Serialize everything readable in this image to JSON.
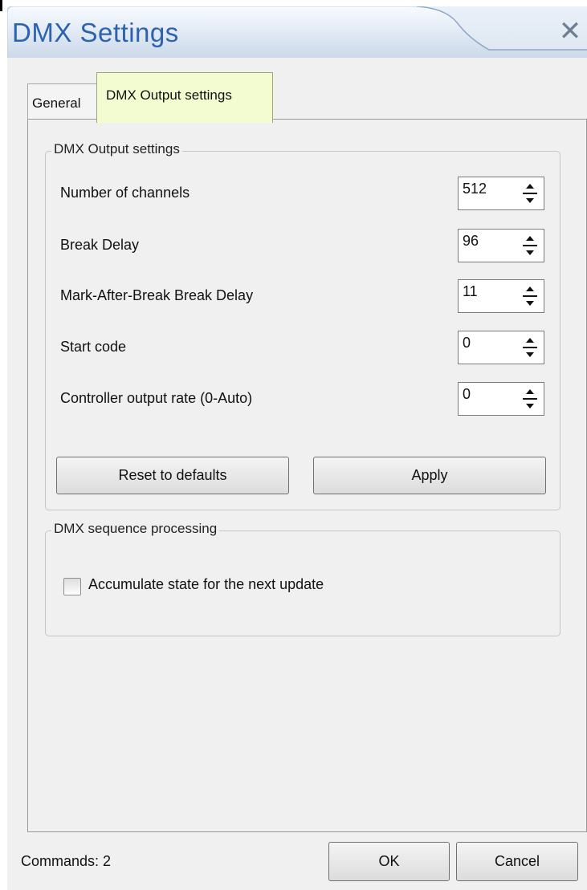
{
  "window": {
    "title": "DMX Settings",
    "close_icon": "close-icon",
    "title_color": "#2d63ad"
  },
  "tabs": [
    {
      "label": "General",
      "active": false
    },
    {
      "label": "DMX Output settings",
      "active": true,
      "color": "#f2fcd0"
    }
  ],
  "output_group": {
    "legend": "DMX Output settings",
    "fields": [
      {
        "label": "Number of channels",
        "value": "512"
      },
      {
        "label": "Break Delay",
        "value": "96"
      },
      {
        "label": "Mark-After-Break Break Delay",
        "value": "11"
      },
      {
        "label": "Start code",
        "value": "0"
      },
      {
        "label": "Controller output rate (0-Auto)",
        "value": "0"
      }
    ],
    "reset_label": "Reset to defaults",
    "apply_label": "Apply"
  },
  "sequence_group": {
    "legend": "DMX sequence processing",
    "checkbox_label": "Accumulate state for the next update",
    "checked": false
  },
  "footer": {
    "status": "Commands: 2",
    "ok_label": "OK",
    "cancel_label": "Cancel"
  }
}
